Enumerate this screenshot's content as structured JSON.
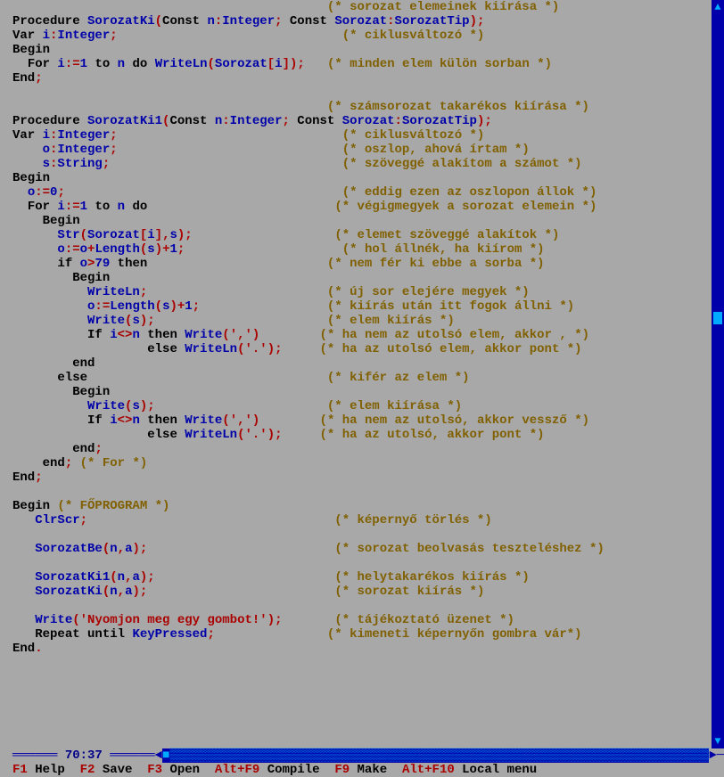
{
  "code_lines": [
    [
      [
        "",
        "                                          "
      ],
      [
        "cmt",
        "(* sorozat elemeinek kiírása *)"
      ]
    ],
    [
      [
        "key",
        "Procedure "
      ],
      [
        "id",
        "SorozatKi"
      ],
      [
        "sym",
        "("
      ],
      [
        "key",
        "Const "
      ],
      [
        "id",
        "n"
      ],
      [
        "sym",
        ":"
      ],
      [
        "id",
        "Integer"
      ],
      [
        "sym",
        "; "
      ],
      [
        "key",
        "Const "
      ],
      [
        "id",
        "Sorozat"
      ],
      [
        "sym",
        ":"
      ],
      [
        "id",
        "SorozatTip"
      ],
      [
        "sym",
        ");"
      ]
    ],
    [
      [
        "key",
        "Var "
      ],
      [
        "id",
        "i"
      ],
      [
        "sym",
        ":"
      ],
      [
        "id",
        "Integer"
      ],
      [
        "sym",
        ";"
      ],
      [
        "",
        "                              "
      ],
      [
        "cmt",
        "(* ciklusváltozó *)"
      ]
    ],
    [
      [
        "key",
        "Begin"
      ]
    ],
    [
      [
        "",
        "  "
      ],
      [
        "key",
        "For "
      ],
      [
        "id",
        "i"
      ],
      [
        "sym",
        ":="
      ],
      [
        "num",
        "1"
      ],
      [
        "",
        " "
      ],
      [
        "key",
        "to "
      ],
      [
        "id",
        "n"
      ],
      [
        "",
        " "
      ],
      [
        "key",
        "do "
      ],
      [
        "id",
        "WriteLn"
      ],
      [
        "sym",
        "("
      ],
      [
        "id",
        "Sorozat"
      ],
      [
        "sym",
        "["
      ],
      [
        "id",
        "i"
      ],
      [
        "sym",
        "]);"
      ],
      [
        "",
        "   "
      ],
      [
        "cmt",
        "(* minden elem külön sorban *)"
      ]
    ],
    [
      [
        "key",
        "End"
      ],
      [
        "sym",
        ";"
      ]
    ],
    [
      [
        "",
        ""
      ]
    ],
    [
      [
        "",
        "                                          "
      ],
      [
        "cmt",
        "(* számsorozat takarékos kiírása *)"
      ]
    ],
    [
      [
        "key",
        "Procedure "
      ],
      [
        "id",
        "SorozatKi1"
      ],
      [
        "sym",
        "("
      ],
      [
        "key",
        "Const "
      ],
      [
        "id",
        "n"
      ],
      [
        "sym",
        ":"
      ],
      [
        "id",
        "Integer"
      ],
      [
        "sym",
        "; "
      ],
      [
        "key",
        "Const "
      ],
      [
        "id",
        "Sorozat"
      ],
      [
        "sym",
        ":"
      ],
      [
        "id",
        "SorozatTip"
      ],
      [
        "sym",
        ");"
      ]
    ],
    [
      [
        "key",
        "Var "
      ],
      [
        "id",
        "i"
      ],
      [
        "sym",
        ":"
      ],
      [
        "id",
        "Integer"
      ],
      [
        "sym",
        ";"
      ],
      [
        "",
        "                              "
      ],
      [
        "cmt",
        "(* ciklusváltozó *)"
      ]
    ],
    [
      [
        "",
        "    "
      ],
      [
        "id",
        "o"
      ],
      [
        "sym",
        ":"
      ],
      [
        "id",
        "Integer"
      ],
      [
        "sym",
        ";"
      ],
      [
        "",
        "                              "
      ],
      [
        "cmt",
        "(* oszlop, ahová írtam *)"
      ]
    ],
    [
      [
        "",
        "    "
      ],
      [
        "id",
        "s"
      ],
      [
        "sym",
        ":"
      ],
      [
        "id",
        "String"
      ],
      [
        "sym",
        ";"
      ],
      [
        "",
        "                               "
      ],
      [
        "cmt",
        "(* szöveggé alakítom a számot *)"
      ]
    ],
    [
      [
        "key",
        "Begin"
      ]
    ],
    [
      [
        "",
        "  "
      ],
      [
        "id",
        "o"
      ],
      [
        "sym",
        ":="
      ],
      [
        "num",
        "0"
      ],
      [
        "sym",
        ";"
      ],
      [
        "",
        "                                     "
      ],
      [
        "cmt",
        "(* eddig ezen az oszlopon állok *)"
      ]
    ],
    [
      [
        "",
        "  "
      ],
      [
        "key",
        "For "
      ],
      [
        "id",
        "i"
      ],
      [
        "sym",
        ":="
      ],
      [
        "num",
        "1"
      ],
      [
        "",
        " "
      ],
      [
        "key",
        "to "
      ],
      [
        "id",
        "n"
      ],
      [
        "",
        " "
      ],
      [
        "key",
        "do"
      ],
      [
        "",
        "                         "
      ],
      [
        "cmt",
        "(* végigmegyek a sorozat elemein *)"
      ]
    ],
    [
      [
        "",
        "    "
      ],
      [
        "key",
        "Begin"
      ]
    ],
    [
      [
        "",
        "      "
      ],
      [
        "id",
        "Str"
      ],
      [
        "sym",
        "("
      ],
      [
        "id",
        "Sorozat"
      ],
      [
        "sym",
        "["
      ],
      [
        "id",
        "i"
      ],
      [
        "sym",
        "],"
      ],
      [
        "id",
        "s"
      ],
      [
        "sym",
        ");"
      ],
      [
        "",
        "                   "
      ],
      [
        "cmt",
        "(* elemet szöveggé alakítok *)"
      ]
    ],
    [
      [
        "",
        "      "
      ],
      [
        "id",
        "o"
      ],
      [
        "sym",
        ":="
      ],
      [
        "id",
        "o"
      ],
      [
        "sym",
        "+"
      ],
      [
        "id",
        "Length"
      ],
      [
        "sym",
        "("
      ],
      [
        "id",
        "s"
      ],
      [
        "sym",
        ")+"
      ],
      [
        "num",
        "1"
      ],
      [
        "sym",
        ";"
      ],
      [
        "",
        "                     "
      ],
      [
        "cmt",
        "(* hol állnék, ha kiírom *)"
      ]
    ],
    [
      [
        "",
        "      "
      ],
      [
        "key",
        "if "
      ],
      [
        "id",
        "o"
      ],
      [
        "sym",
        ">"
      ],
      [
        "num",
        "79"
      ],
      [
        "",
        " "
      ],
      [
        "key",
        "then"
      ],
      [
        "",
        "                        "
      ],
      [
        "cmt",
        "(* nem fér ki ebbe a sorba *)"
      ]
    ],
    [
      [
        "",
        "        "
      ],
      [
        "key",
        "Begin"
      ]
    ],
    [
      [
        "",
        "          "
      ],
      [
        "id",
        "WriteLn"
      ],
      [
        "sym",
        ";"
      ],
      [
        "",
        "                        "
      ],
      [
        "cmt",
        "(* új sor elejére megyek *)"
      ]
    ],
    [
      [
        "",
        "          "
      ],
      [
        "id",
        "o"
      ],
      [
        "sym",
        ":="
      ],
      [
        "id",
        "Length"
      ],
      [
        "sym",
        "("
      ],
      [
        "id",
        "s"
      ],
      [
        "sym",
        ")+"
      ],
      [
        "num",
        "1"
      ],
      [
        "sym",
        ";"
      ],
      [
        "",
        "                 "
      ],
      [
        "cmt",
        "(* kiírás után itt fogok állni *)"
      ]
    ],
    [
      [
        "",
        "          "
      ],
      [
        "id",
        "Write"
      ],
      [
        "sym",
        "("
      ],
      [
        "id",
        "s"
      ],
      [
        "sym",
        ");"
      ],
      [
        "",
        "                       "
      ],
      [
        "cmt",
        "(* elem kiírás *)"
      ]
    ],
    [
      [
        "",
        "          "
      ],
      [
        "key",
        "If "
      ],
      [
        "id",
        "i"
      ],
      [
        "sym",
        "<>"
      ],
      [
        "id",
        "n"
      ],
      [
        "",
        " "
      ],
      [
        "key",
        "then "
      ],
      [
        "id",
        "Write"
      ],
      [
        "sym",
        "("
      ],
      [
        "str",
        "','"
      ],
      [
        "sym",
        ")"
      ],
      [
        "",
        "        "
      ],
      [
        "cmt",
        "(* ha nem az utolsó elem, akkor , *)"
      ]
    ],
    [
      [
        "",
        "                  "
      ],
      [
        "key",
        "else "
      ],
      [
        "id",
        "WriteLn"
      ],
      [
        "sym",
        "("
      ],
      [
        "str",
        "'.'"
      ],
      [
        "sym",
        ");"
      ],
      [
        "",
        "     "
      ],
      [
        "cmt",
        "(* ha az utolsó elem, akkor pont *)"
      ]
    ],
    [
      [
        "",
        "        "
      ],
      [
        "key",
        "end"
      ]
    ],
    [
      [
        "",
        "      "
      ],
      [
        "key",
        "else"
      ],
      [
        "",
        "                                "
      ],
      [
        "cmt",
        "(* kifér az elem *)"
      ]
    ],
    [
      [
        "",
        "        "
      ],
      [
        "key",
        "Begin"
      ]
    ],
    [
      [
        "",
        "          "
      ],
      [
        "id",
        "Write"
      ],
      [
        "sym",
        "("
      ],
      [
        "id",
        "s"
      ],
      [
        "sym",
        ");"
      ],
      [
        "",
        "                       "
      ],
      [
        "cmt",
        "(* elem kiírása *)"
      ]
    ],
    [
      [
        "",
        "          "
      ],
      [
        "key",
        "If "
      ],
      [
        "id",
        "i"
      ],
      [
        "sym",
        "<>"
      ],
      [
        "id",
        "n"
      ],
      [
        "",
        " "
      ],
      [
        "key",
        "then "
      ],
      [
        "id",
        "Write"
      ],
      [
        "sym",
        "("
      ],
      [
        "str",
        "','"
      ],
      [
        "sym",
        ")"
      ],
      [
        "",
        "        "
      ],
      [
        "cmt",
        "(* ha nem az utolsó, akkor vessző *)"
      ]
    ],
    [
      [
        "",
        "                  "
      ],
      [
        "key",
        "else "
      ],
      [
        "id",
        "WriteLn"
      ],
      [
        "sym",
        "("
      ],
      [
        "str",
        "'.'"
      ],
      [
        "sym",
        ");"
      ],
      [
        "",
        "     "
      ],
      [
        "cmt",
        "(* ha az utolsó, akkor pont *)"
      ]
    ],
    [
      [
        "",
        "        "
      ],
      [
        "key",
        "end"
      ],
      [
        "sym",
        ";"
      ]
    ],
    [
      [
        "",
        "    "
      ],
      [
        "key",
        "end"
      ],
      [
        "sym",
        "; "
      ],
      [
        "cmt",
        "(* For *)"
      ]
    ],
    [
      [
        "key",
        "End"
      ],
      [
        "sym",
        ";"
      ]
    ],
    [
      [
        "",
        ""
      ]
    ],
    [
      [
        "key",
        "Begin "
      ],
      [
        "cmt",
        "(* FŐPROGRAM *)"
      ]
    ],
    [
      [
        "",
        "   "
      ],
      [
        "id",
        "ClrScr"
      ],
      [
        "sym",
        ";"
      ],
      [
        "",
        "                                 "
      ],
      [
        "cmt",
        "(* képernyő törlés *)"
      ]
    ],
    [
      [
        "",
        ""
      ]
    ],
    [
      [
        "",
        "   "
      ],
      [
        "id",
        "SorozatBe"
      ],
      [
        "sym",
        "("
      ],
      [
        "id",
        "n"
      ],
      [
        "sym",
        ","
      ],
      [
        "id",
        "a"
      ],
      [
        "sym",
        ");"
      ],
      [
        "",
        "                         "
      ],
      [
        "cmt",
        "(* sorozat beolvasás teszteléshez *)"
      ]
    ],
    [
      [
        "",
        ""
      ]
    ],
    [
      [
        "",
        "   "
      ],
      [
        "id",
        "SorozatKi1"
      ],
      [
        "sym",
        "("
      ],
      [
        "id",
        "n"
      ],
      [
        "sym",
        ","
      ],
      [
        "id",
        "a"
      ],
      [
        "sym",
        ");"
      ],
      [
        "",
        "                        "
      ],
      [
        "cmt",
        "(* helytakarékos kiírás *)"
      ]
    ],
    [
      [
        "",
        "   "
      ],
      [
        "id",
        "SorozatKi"
      ],
      [
        "sym",
        "("
      ],
      [
        "id",
        "n"
      ],
      [
        "sym",
        ","
      ],
      [
        "id",
        "a"
      ],
      [
        "sym",
        ");"
      ],
      [
        "",
        "                         "
      ],
      [
        "cmt",
        "(* sorozat kiírás *)"
      ]
    ],
    [
      [
        "",
        ""
      ]
    ],
    [
      [
        "",
        "   "
      ],
      [
        "id",
        "Write"
      ],
      [
        "sym",
        "("
      ],
      [
        "str",
        "'Nyomjon meg egy gombot!'"
      ],
      [
        "sym",
        ");"
      ],
      [
        "",
        "       "
      ],
      [
        "cmt",
        "(* tájékoztató üzenet *)"
      ]
    ],
    [
      [
        "",
        "   "
      ],
      [
        "key",
        "Repeat until "
      ],
      [
        "id",
        "KeyPressed"
      ],
      [
        "sym",
        ";"
      ],
      [
        "",
        "               "
      ],
      [
        "cmt",
        "(* kimeneti képernyőn gombra vár*)"
      ]
    ],
    [
      [
        "key",
        "End"
      ],
      [
        "sym",
        "."
      ]
    ]
  ],
  "status": {
    "pos": "70:37"
  },
  "menu": [
    {
      "hot": "F1",
      "label": " Help  "
    },
    {
      "hot": "F2",
      "label": " Save  "
    },
    {
      "hot": "F3",
      "label": " Open  "
    },
    {
      "hot": "Alt+F9",
      "label": " Compile  "
    },
    {
      "hot": "F9",
      "label": " Make  "
    },
    {
      "hot": "Alt+F10",
      "label": " Local menu"
    }
  ],
  "scroll": {
    "up_arrow": "▲",
    "down_arrow": "▼",
    "left_arrow": "◄",
    "right_arrow": "►"
  }
}
